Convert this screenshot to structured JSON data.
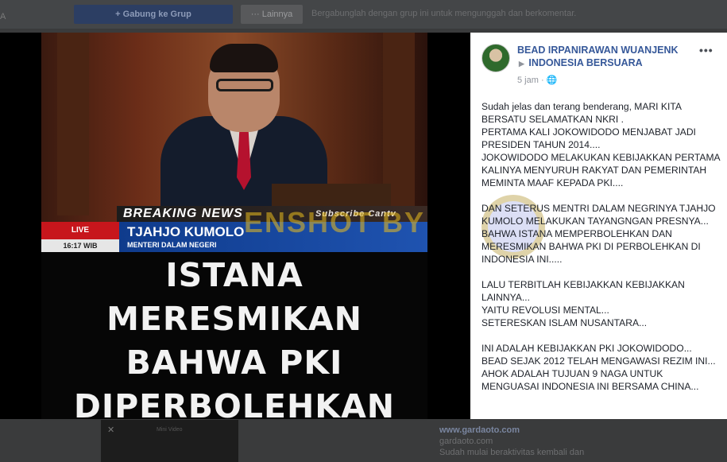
{
  "background": {
    "join_button": "+ Gabung ke Grup",
    "more_button": "··· Lainnya",
    "hint": "Bergabunglah dengan grup ini untuk mengunggah dan berkomentar.",
    "left_letters": "A",
    "mini_video_label": "Mini Video",
    "ad_title": "www.gardaoto.com",
    "ad_domain": "gardaoto.com",
    "ad_line": "Sudah mulai beraktivitas kembali dan"
  },
  "photo": {
    "banner": "BREAKING NEWS",
    "subscribe": "Subscribe Cantv Channel",
    "live": "LIVE",
    "clock": "16:17 WIB",
    "name": "TJAHJO KUMOLO",
    "role": "MENTERI DALAM NEGERI",
    "watermark": "ENSHOT BY",
    "caption": "ISTANA MERESMIKAN\nBAHWA PKI\nDIPERBOLEHKAN\nDI INDONESIA."
  },
  "post": {
    "author": "BEAD IRPANIRAWAN WUANJENK",
    "group": "INDONESIA BERSUARA",
    "time": "5 jam",
    "more": "•••",
    "text": "Sudah jelas dan terang benderang, MARI KITA BERSATU SELAMATKAN NKRI .\nPERTAMA KALI JOKOWIDODO MENJABAT JADI PRESIDEN TAHUN 2014....\nJOKOWIDODO MELAKUKAN KEBIJAKKAN PERTAMA KALINYA MENYURUH RAKYAT DAN PEMERINTAH MEMINTA MAAF KEPADA PKI....\n\nDAN SETERUS MENTRI DALAM NEGRINYA TJAHJO KUMOLO MELAKUKAN TAYANGNGAN PRESNYA...\nBAHWA ISTANA MEMPERBOLEHKAN DAN MERESMIKAN BAHWA PKI DI PERBOLEHKAN DI INDONESIA INI.....\n\nLALU TERBITLAH KEBIJAKKAN KEBIJAKKAN LAINNYA...\nYAITU REVOLUSI MENTAL...\nSETERESKAN ISLAM NUSANTARA...\n\nINI ADALAH KEBIJAKKAN PKI JOKOWIDODO...\nBEAD SEJAK 2012 TELAH MENGAWASI REZIM INI...\nAHOK ADALAH TUJUAN 9 NAGA UNTUK MENGUASAI INDONESIA INI BERSAMA CHINA..."
  }
}
